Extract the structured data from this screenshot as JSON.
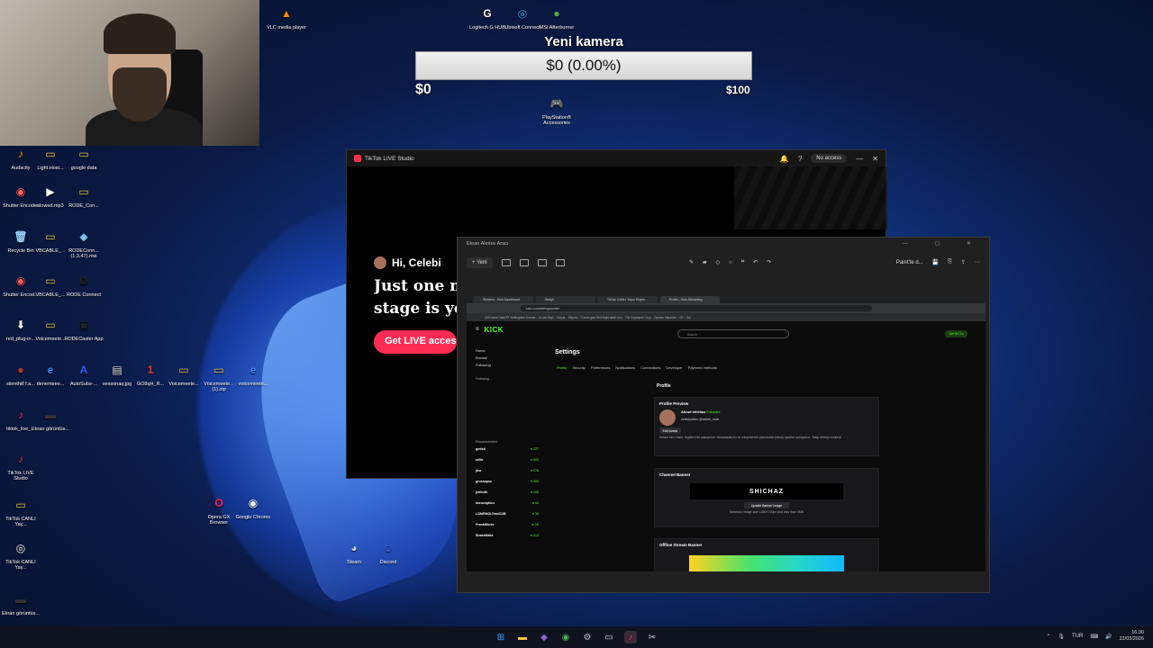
{
  "overlay": {
    "title": "Yeni kamera",
    "value": "$0 (0.00%)",
    "min": "$0",
    "max": "$100"
  },
  "desktop_icons": [
    {
      "label": "VLC media player",
      "color": "#ff8800",
      "glyph": "▲"
    },
    {
      "label": "Logitech G HUB",
      "color": "#ffffff",
      "glyph": "G"
    },
    {
      "label": "Ubisoft Connect",
      "color": "#3ea6ff",
      "glyph": "◎"
    },
    {
      "label": "MSI Afterburner",
      "color": "#4caf50",
      "glyph": "●"
    },
    {
      "label": "PlayStation® Accessories",
      "color": "#1f6fe5",
      "glyph": "🎮"
    },
    {
      "label": "Audacity",
      "color": "#f0a500",
      "glyph": "♪"
    },
    {
      "label": "Light.Host...",
      "color": "#e6c253",
      "glyph": "▭"
    },
    {
      "label": "google data",
      "color": "#e6c253",
      "glyph": "▭"
    },
    {
      "label": "Shutter Encoder",
      "color": "#ff5a5a",
      "glyph": "◉"
    },
    {
      "label": "slowed.mp3",
      "color": "#ffffff",
      "glyph": "▶"
    },
    {
      "label": "RODE_Con...",
      "color": "#e6c253",
      "glyph": "▭"
    },
    {
      "label": "Recycle Bin",
      "color": "#9fd3ff",
      "glyph": "🗑"
    },
    {
      "label": "VBCABLE_...",
      "color": "#e6c253",
      "glyph": "▭"
    },
    {
      "label": "RODEConn... (1.3.47).msi",
      "color": "#7bc0e0",
      "glyph": "◆"
    },
    {
      "label": "Shutter Encod...",
      "color": "#ff5a5a",
      "glyph": "◉"
    },
    {
      "label": "VBCABLE_...",
      "color": "#e6c253",
      "glyph": "▭"
    },
    {
      "label": "RODE Connect",
      "color": "#222222",
      "glyph": "Ø"
    },
    {
      "label": "red_plug-in...",
      "color": "#ffffff",
      "glyph": "⬇"
    },
    {
      "label": "Voicemeete...",
      "color": "#e6c253",
      "glyph": "▭"
    },
    {
      "label": "RODECaster App",
      "color": "#222222",
      "glyph": "▣"
    },
    {
      "label": "silenthill f.a...",
      "color": "#c0392b",
      "glyph": "●"
    },
    {
      "label": "denemeee...",
      "color": "#1e90ff",
      "glyph": "e"
    },
    {
      "label": "AutoSubs-...",
      "color": "#2962ff",
      "glyph": "A"
    },
    {
      "label": "sessonaq.jpg",
      "color": "#dddddd",
      "glyph": "▤"
    },
    {
      "label": "GO8qH_R...",
      "color": "#e53935",
      "glyph": "1"
    },
    {
      "label": "Voicemeete...",
      "color": "#e6c253",
      "glyph": "▭"
    },
    {
      "label": "Voicemeete... (1).zip",
      "color": "#e6c253",
      "glyph": "▭"
    },
    {
      "label": "voicemeete...",
      "color": "#1e90ff",
      "glyph": "e"
    },
    {
      "label": "tiktok_live_...",
      "color": "#fe2c55",
      "glyph": "♪"
    },
    {
      "label": "Ekran görüntüs...",
      "color": "#333333",
      "glyph": "▬"
    },
    {
      "label": "TikTok LIVE Studio",
      "color": "#fe2c55",
      "glyph": "♪"
    },
    {
      "label": "TikTok CANLI Yay...",
      "color": "#e6c253",
      "glyph": "▭"
    },
    {
      "label": "TikTok CANLI Yay...",
      "color": "#ffffff",
      "glyph": "◎"
    },
    {
      "label": "Ekran görüntüs...",
      "color": "#333333",
      "glyph": "▬"
    },
    {
      "label": "Opera GX Browser",
      "color": "#ff1b5a",
      "glyph": "O"
    },
    {
      "label": "Google Chrome",
      "color": "#ffffff",
      "glyph": "◉"
    },
    {
      "label": "Steam",
      "color": "#c7d5e0",
      "glyph": "◕"
    },
    {
      "label": "Discord",
      "color": "#5865f2",
      "glyph": "☺"
    }
  ],
  "tiktok": {
    "window_title": "TikTok LIVE Studio",
    "no_access": "No access",
    "greeting": "Hi, Celebi",
    "headline_1": "Just one m",
    "headline_2": "stage is you",
    "cta": "Get LIVE acces"
  },
  "snipping": {
    "window_title": "Ekran Alıntısı Aracı",
    "new_label": "Yeni",
    "paint_label": "Paint'te d..."
  },
  "kick": {
    "tabs": [
      "Streams - Kick Dashboard",
      "Sleigh",
      "TikTok CANLI Yayın Ekipm",
      "Profile - Kick Streaming"
    ],
    "url": "kick.com/settings/profile",
    "bookmarks": "CEN  sent  ChatGPT  Nottingham Corona...  Ucuza Suyk - Sosyal...  Ekipme - Tr.scuz.gdw  Red Night skull: nes...  The Cryptopub Cryp...  Oyuncu Yapanları - OE...  Bol",
    "brand": "KICK",
    "search": "Search",
    "get_kicks": "Get KICKs",
    "nav": [
      "Home",
      "Browse",
      "Following"
    ],
    "following_title": "Following",
    "following": [
      "...",
      "...",
      "...",
      "...",
      "..."
    ],
    "recommended_title": "Recommended",
    "recommended": [
      {
        "name": "gmfsti",
        "count": "227"
      },
      {
        "name": "rellik",
        "count": "302"
      },
      {
        "name": "jlea",
        "count": "278"
      },
      {
        "name": "grossapse",
        "count": "309"
      },
      {
        "name": "jsnforth",
        "count": "106"
      },
      {
        "name": "buruception",
        "count": "44"
      },
      {
        "name": "LONEWOLFactCUB",
        "count": "36"
      },
      {
        "name": "FrankWines",
        "count": "2K"
      },
      {
        "name": "ShakeMake",
        "count": "413"
      }
    ],
    "settings_title": "Settings",
    "settings_tabs": [
      "Profile",
      "Security",
      "Preferences",
      "Notifications",
      "Connections",
      "Developer",
      "Payment methods"
    ],
    "profile_heading": "Profile",
    "preview_title": "Profile Preview",
    "about": "About shichaz",
    "followers": "Followers",
    "socials": "celebiyasinn    @celebi_nutis",
    "edit_avatar": "Edit Avatar",
    "bio": "Selam ben Yasin, İngiltere'de yaşıyorum. Arkadaşlarımı ve izleyicilerimi yanımızda (ideal) oyunlar oynuyoruz. Takip etmeyi unutma!",
    "channel_banner": "Channel Banner",
    "banner_text": "SHICHAZ",
    "update_banner": "Update Banner Image",
    "banner_hint": "Minimum image size 1280×720px and less than 4MB",
    "offline_banner": "Offline Stream Banner"
  },
  "tray": {
    "lang": "TUR",
    "time": "16:30",
    "date": "22/03/2026"
  }
}
